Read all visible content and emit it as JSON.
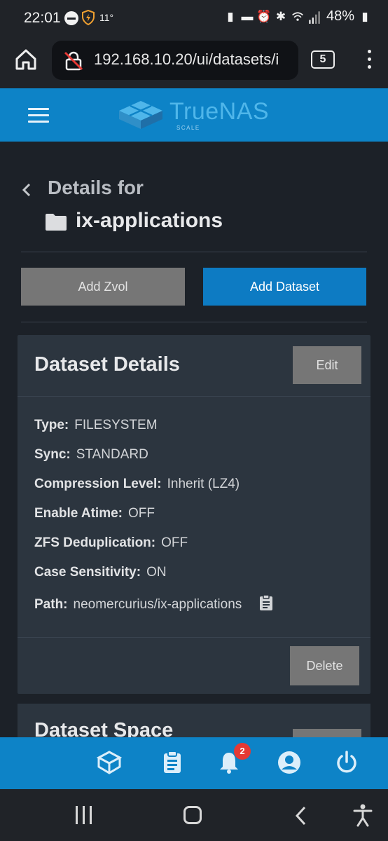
{
  "status_bar": {
    "time": "22:01",
    "temperature": "11°",
    "battery": "48%"
  },
  "browser": {
    "url": "192.168.10.20/ui/datasets/i",
    "tab_count": "5"
  },
  "app": {
    "brand": "TrueNAS",
    "brand_sub": "SCALE",
    "accent_color": "#0d83c7"
  },
  "page": {
    "details_for": "Details for",
    "dataset_name": "ix-applications",
    "add_zvol": "Add Zvol",
    "add_dataset": "Add Dataset"
  },
  "dataset_details": {
    "title": "Dataset Details",
    "edit": "Edit",
    "delete": "Delete",
    "rows": [
      {
        "label": "Type:",
        "value": "FILESYSTEM"
      },
      {
        "label": "Sync:",
        "value": "STANDARD"
      },
      {
        "label": "Compression Level:",
        "value": "Inherit (LZ4)"
      },
      {
        "label": "Enable Atime:",
        "value": "OFF"
      },
      {
        "label": "ZFS Deduplication:",
        "value": "OFF"
      },
      {
        "label": "Case Sensitivity:",
        "value": "ON"
      },
      {
        "label": "Path:",
        "value": "neomercurius/ix-applications"
      }
    ]
  },
  "dataset_space": {
    "title": "Dataset Space"
  },
  "bottom_nav": {
    "notification_count": "2"
  }
}
